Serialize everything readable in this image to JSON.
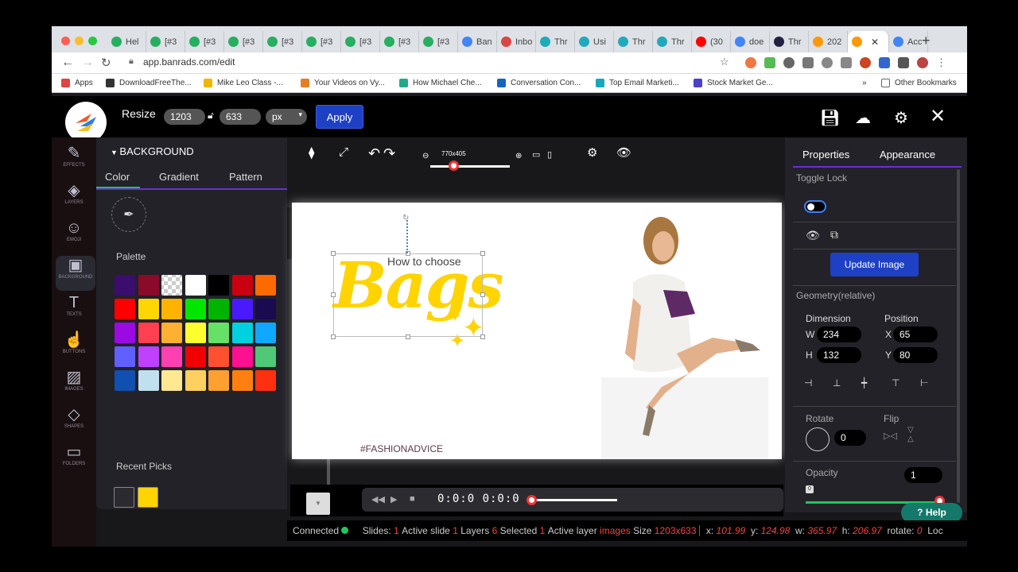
{
  "browser": {
    "tabs": [
      {
        "label": "Hel",
        "color": "#27ae60"
      },
      {
        "label": "[#3",
        "color": "#27ae60"
      },
      {
        "label": "[#3",
        "color": "#27ae60"
      },
      {
        "label": "[#3",
        "color": "#27ae60"
      },
      {
        "label": "[#3",
        "color": "#27ae60"
      },
      {
        "label": "[#3",
        "color": "#27ae60"
      },
      {
        "label": "[#3",
        "color": "#27ae60"
      },
      {
        "label": "[#3",
        "color": "#27ae60"
      },
      {
        "label": "[#3",
        "color": "#27ae60"
      },
      {
        "label": "Ban",
        "color": "#4285f4"
      },
      {
        "label": "Inbo",
        "color": "#d44"
      },
      {
        "label": "Thr",
        "color": "#2ab"
      },
      {
        "label": "Usi",
        "color": "#2ab"
      },
      {
        "label": "Thr",
        "color": "#2ab"
      },
      {
        "label": "Thr",
        "color": "#2ab"
      },
      {
        "label": "(30",
        "color": "#f00"
      },
      {
        "label": "doe",
        "color": "#4285f4"
      },
      {
        "label": "Thr",
        "color": "#224"
      },
      {
        "label": "202",
        "color": "#f90"
      }
    ],
    "active_tab": "",
    "last_tab": "Acc",
    "url": "app.banrads.com/edit",
    "bookmarks": [
      {
        "label": "Apps",
        "color": "#d44"
      },
      {
        "label": "DownloadFreeThe...",
        "color": "#333"
      },
      {
        "label": "Mike Leo Class -...",
        "color": "#f4b400"
      },
      {
        "label": "Your Videos on Vy...",
        "color": "#e67e22"
      },
      {
        "label": "How Michael Che...",
        "color": "#2a8"
      },
      {
        "label": "Conversation Con...",
        "color": "#1565c0"
      },
      {
        "label": "Top Email Marketi...",
        "color": "#1ab"
      },
      {
        "label": "Stock Market Ge...",
        "color": "#4a3fcf"
      }
    ],
    "bookmarks_more": "»",
    "other_bookmarks": "Other Bookmarks"
  },
  "topbar": {
    "resize_label": "Resize",
    "width": "1203",
    "height": "633",
    "unit": "px",
    "apply": "Apply"
  },
  "rail": [
    {
      "label": "EFFECTS",
      "icon": "✎"
    },
    {
      "label": "LAYERS",
      "icon": "◈"
    },
    {
      "label": "EMOJI",
      "icon": "☺"
    },
    {
      "label": "BACKGROUND",
      "icon": "▣"
    },
    {
      "label": "TEXTS",
      "icon": "T"
    },
    {
      "label": "BUTTONS",
      "icon": "☝"
    },
    {
      "label": "IMAGES",
      "icon": "▨"
    },
    {
      "label": "SHAPES",
      "icon": "◇"
    },
    {
      "label": "FOLDERS",
      "icon": "▭"
    }
  ],
  "bgpanel": {
    "title": "BACKGROUND",
    "tabs": [
      "Color",
      "Gradient",
      "Pattern"
    ],
    "palette_label": "Palette",
    "palette": [
      "#3a0d6e",
      "#8b0a2a",
      "checker",
      "#ffffff",
      "#000000",
      "#c8000f",
      "#ff6a00",
      "#ff0000",
      "#ffd600",
      "#ffb300",
      "#00e600",
      "#00b300",
      "#4a1aff",
      "#1a0a50",
      "#9b0ae0",
      "#ff4050",
      "#ffb030",
      "#ffff30",
      "#66e066",
      "#00d0e0",
      "#10a8ff",
      "#6060ff",
      "#c040ff",
      "#ff40b0",
      "#f00000",
      "#ff5030",
      "#ff1090",
      "#50c878",
      "#1050b0",
      "#c0e0f0",
      "#ffe890",
      "#ffd060",
      "#ffa030",
      "#ff8010",
      "#ff3010"
    ],
    "recent_label": "Recent Picks",
    "recent": [
      "#2a2a30",
      "#ffd400"
    ]
  },
  "toolbar": {
    "zoom_label": "770x405"
  },
  "canvas": {
    "howto": "How to choose",
    "bags": "Bags",
    "hashtag": "#FASHIONADVICE"
  },
  "timeline": {
    "time": "0:0:0  0:0:0"
  },
  "right": {
    "tabs": [
      "Properties",
      "Appearance"
    ],
    "toggle_lock": "Toggle Lock",
    "update_image": "Update Image",
    "geometry": "Geometry(relative)",
    "dimension": "Dimension",
    "position": "Position",
    "w_lbl": "W",
    "w": "234",
    "h_lbl": "H",
    "h": "132",
    "x_lbl": "X",
    "x": "65",
    "y_lbl": "Y",
    "y": "80",
    "rotate": "Rotate",
    "rotate_val": "0",
    "flip": "Flip",
    "opacity": "Opacity",
    "opacity_val": "1",
    "opacity_min": "0"
  },
  "help": "Help",
  "status": {
    "connected": "Connected",
    "slides_lbl": "Slides:",
    "slides": "1",
    "active_slide_lbl": "Active slide",
    "active_slide": "1",
    "layers_lbl": "Layers",
    "layers": "6",
    "selected_lbl": "Selected",
    "selected": "1",
    "active_layer_lbl": "Active layer",
    "active_layer": "images",
    "size_lbl": "Size",
    "size": "1203x633",
    "x_lbl": "x:",
    "x": "101.99",
    "y_lbl": "y:",
    "y": "124.98",
    "w_lbl": "w:",
    "w": "365.97",
    "h_lbl": "h:",
    "h": "206.97",
    "rot_lbl": "rotate:",
    "rot": "0",
    "loc": "Loc"
  }
}
